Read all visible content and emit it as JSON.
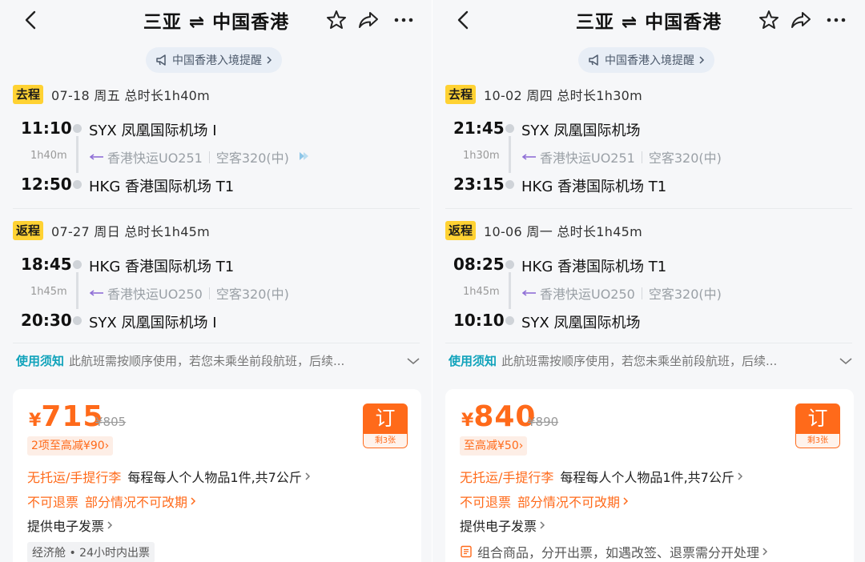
{
  "panels": [
    {
      "nav": {
        "title": "三亚 ⇌ 中国香港"
      },
      "notice": "中国香港入境提醒",
      "outbound": {
        "badge": "去程",
        "date": "07-18 周五 总时长1h40m",
        "dep_time": "11:10",
        "dep_airport": "SYX 凤凰国际机场 I",
        "duration": "1h40m",
        "flight": "香港快运UO251",
        "aircraft": "空客320(中)",
        "arr_time": "12:50",
        "arr_airport": "HKG 香港国际机场 T1"
      },
      "return": {
        "badge": "返程",
        "date": "07-27 周日 总时长1h45m",
        "dep_time": "18:45",
        "dep_airport": "HKG 香港国际机场 T1",
        "duration": "1h45m",
        "flight": "香港快运UO250",
        "aircraft": "空客320(中)",
        "arr_time": "20:30",
        "arr_airport": "SYX 凤凰国际机场 I"
      },
      "rules": {
        "label": "使用须知",
        "text": "此航班需按顺序使用，若您未乘坐前段航班，后续..."
      },
      "card": {
        "currency": "¥",
        "price": "715",
        "orig_price": "¥805",
        "discount": "2项至高减¥90",
        "book_label": "订",
        "remaining": "剩3张",
        "baggage_key": "无托运/手提行李",
        "baggage_val": "每程每人个人物品1件,共7公斤",
        "refund_a": "不可退票",
        "refund_b": "部分情况不可改期",
        "invoice": "提供电子发票",
        "extra": "经济舱 • 24小时内出票"
      }
    },
    {
      "nav": {
        "title": "三亚 ⇌ 中国香港"
      },
      "notice": "中国香港入境提醒",
      "outbound": {
        "badge": "去程",
        "date": "10-02 周四 总时长1h30m",
        "dep_time": "21:45",
        "dep_airport": "SYX 凤凰国际机场",
        "duration": "1h30m",
        "flight": "香港快运UO251",
        "aircraft": "空客320(中)",
        "arr_time": "23:15",
        "arr_airport": "HKG 香港国际机场 T1"
      },
      "return": {
        "badge": "返程",
        "date": "10-06 周一 总时长1h45m",
        "dep_time": "08:25",
        "dep_airport": "HKG 香港国际机场 T1",
        "duration": "1h45m",
        "flight": "香港快运UO250",
        "aircraft": "空客320(中)",
        "arr_time": "10:10",
        "arr_airport": "SYX 凤凰国际机场"
      },
      "rules": {
        "label": "使用须知",
        "text": "此航班需按顺序使用，若您未乘坐前段航班，后续..."
      },
      "card": {
        "currency": "¥",
        "price": "840",
        "orig_price": "¥890",
        "discount": "至高减¥50",
        "book_label": "订",
        "remaining": "剩3张",
        "baggage_key": "无托运/手提行李",
        "baggage_val": "每程每人个人物品1件,共7公斤",
        "refund_a": "不可退票",
        "refund_b": "部分情况不可改期",
        "invoice": "提供电子发票",
        "extra": "组合商品，分开出票，如遇改签、退票需分开处理"
      }
    }
  ],
  "colors": {
    "accent": "#ff6a1a",
    "badge": "#ffd233",
    "link": "#11a3bb"
  }
}
